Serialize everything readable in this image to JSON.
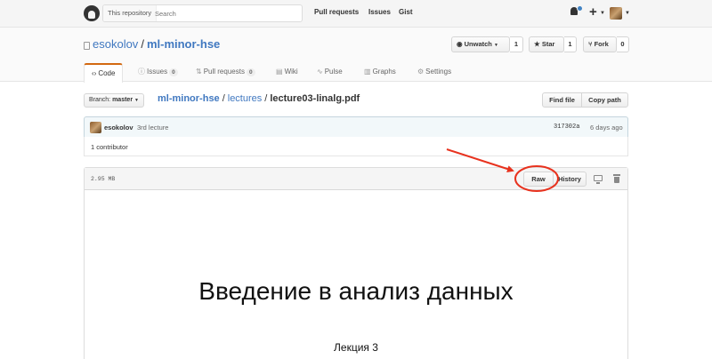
{
  "header": {
    "search_scope": "This repository",
    "search_placeholder": "Search",
    "nav": [
      "Pull requests",
      "Issues",
      "Gist"
    ],
    "plus_label": "+"
  },
  "repo": {
    "owner": "esokolov",
    "name": "ml-minor-hse",
    "unwatch_label": "Unwatch",
    "unwatch_count": "1",
    "star_label": "Star",
    "star_count": "1",
    "fork_label": "Fork",
    "fork_count": "0"
  },
  "tabs": [
    {
      "label": "Code",
      "icon": "code-icon",
      "selected": true
    },
    {
      "label": "Issues",
      "count": "0",
      "icon": "issue-icon"
    },
    {
      "label": "Pull requests",
      "count": "0",
      "icon": "pull-request-icon"
    },
    {
      "label": "Wiki",
      "icon": "book-icon"
    },
    {
      "label": "Pulse",
      "icon": "pulse-icon"
    },
    {
      "label": "Graphs",
      "icon": "graph-icon"
    },
    {
      "label": "Settings",
      "icon": "gear-icon"
    }
  ],
  "filenav": {
    "branch_prefix": "Branch:",
    "branch": "master",
    "crumbs": [
      "ml-minor-hse",
      "lectures",
      "lecture03-linalg.pdf"
    ],
    "find_file": "Find file",
    "copy_path": "Copy path"
  },
  "commit": {
    "author": "esokolov",
    "message": "3rd lecture",
    "sha": "317302a",
    "time": "6 days ago",
    "contributors": "1 contributor"
  },
  "file": {
    "size": "2.95 MB",
    "raw_label": "Raw",
    "history_label": "History",
    "pdf_title": "Введение в анализ данных",
    "pdf_subtitle": "Лекция 3"
  },
  "colors": {
    "link": "#4078c0",
    "tab_accent": "#d26911",
    "annotation": "#e8321e"
  }
}
